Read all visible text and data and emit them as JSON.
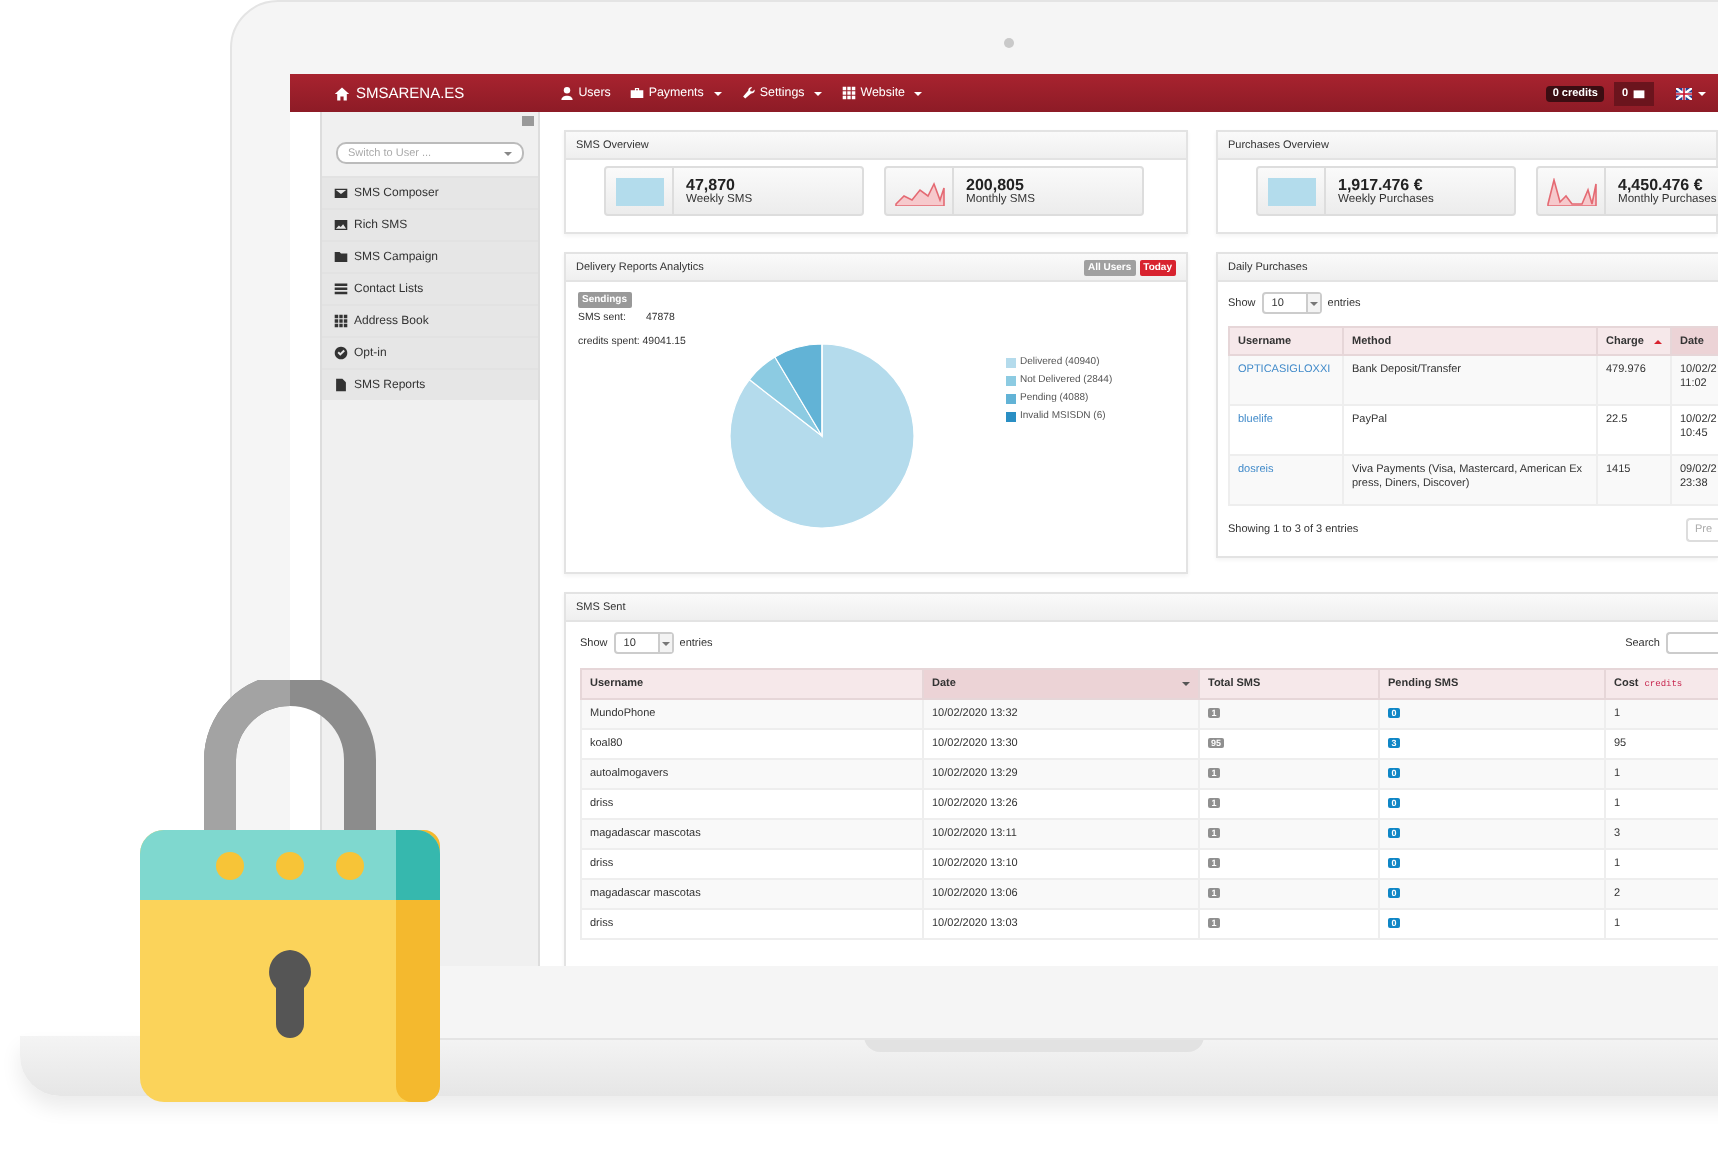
{
  "navbar": {
    "brand": "SMSARENA.ES",
    "menu": [
      {
        "label": "Users",
        "dropdown": false
      },
      {
        "label": "Payments",
        "dropdown": true
      },
      {
        "label": "Settings",
        "dropdown": true
      },
      {
        "label": "Website",
        "dropdown": true
      }
    ],
    "credits": "0 credits",
    "messages": "0"
  },
  "sidebar": {
    "switch_user": {
      "placeholder": "Switch to User ..."
    },
    "items": [
      {
        "label": "SMS Composer"
      },
      {
        "label": "Rich SMS"
      },
      {
        "label": "SMS Campaign"
      },
      {
        "label": "Contact Lists"
      },
      {
        "label": "Address Book"
      },
      {
        "label": "Opt-in"
      },
      {
        "label": "SMS Reports"
      }
    ]
  },
  "sms_overview": {
    "title": "SMS Overview",
    "stats": [
      {
        "kind": "tile",
        "value": "47,870",
        "label": "Weekly SMS"
      },
      {
        "kind": "sparkline",
        "value": "200,805",
        "label": "Monthly SMS"
      }
    ]
  },
  "purchases_overview": {
    "title": "Purchases Overview",
    "stats": [
      {
        "kind": "tile",
        "value": "1,917.476 €",
        "label": "Weekly Purchases"
      },
      {
        "kind": "spikes",
        "value": "4,450.476 €",
        "label": "Monthly Purchases"
      }
    ]
  },
  "delivery_reports": {
    "title": "Delivery Reports Analytics",
    "filters": [
      {
        "label": "All Users",
        "selected": false
      },
      {
        "label": "Today",
        "selected": true
      }
    ],
    "badge": "Sendings",
    "sms_sent_label": "SMS sent:",
    "sms_sent_value": "47878",
    "credits_spent": "credits spent: 49041.15",
    "chart_data": {
      "type": "pie",
      "categories": [
        "Delivered (40940)",
        "Not Delivered (2844)",
        "Pending (4088)",
        "Invalid MSISDN (6)"
      ],
      "values": [
        40940,
        2844,
        4088,
        6
      ]
    }
  },
  "daily_purchases": {
    "title": "Daily Purchases",
    "show_label": "Show",
    "page_size": "10",
    "entries_label": "entries",
    "columns": [
      {
        "label": "Username",
        "sorted": false
      },
      {
        "label": "Method",
        "sorted": false
      },
      {
        "label": "Charge",
        "sorted": true
      },
      {
        "label": "Date",
        "sorted": false
      }
    ],
    "rows": [
      {
        "username": "OPTICASIGLOXXI",
        "method": "Bank Deposit/Transfer",
        "charge": "479.976",
        "date_lines": [
          "10/02/2",
          "11:02"
        ]
      },
      {
        "username": "bluelife",
        "method": "PayPal",
        "charge": "22.5",
        "date_lines": [
          "10/02/2",
          "10:45"
        ]
      },
      {
        "username": "dosreis",
        "method": "Viva Payments (Visa, Mastercard, American Express, Diners, Discover)",
        "charge": "1415",
        "date_lines": [
          "09/02/2",
          "23:38"
        ]
      }
    ],
    "info": "Showing 1 to 3 of 3 entries",
    "prev": "Pre"
  },
  "sms_sent": {
    "title": "SMS Sent",
    "show_label": "Show",
    "page_size": "10",
    "entries_label": "entries",
    "search_label": "Search",
    "columns": [
      {
        "label": "Username",
        "sorted": false
      },
      {
        "label": "Date",
        "sorted": true
      },
      {
        "label": "Total SMS",
        "sorted": false
      },
      {
        "label": "Pending SMS",
        "sorted": false
      },
      {
        "label": "Cost",
        "sorted": false,
        "unit": "credits"
      }
    ],
    "rows": [
      {
        "username": "MundoPhone",
        "date": "10/02/2020 13:32",
        "total": "1",
        "pending": "0",
        "cost": "1"
      },
      {
        "username": "koal80",
        "date": "10/02/2020 13:30",
        "total": "95",
        "pending": "3",
        "cost": "95"
      },
      {
        "username": "autoalmogavers",
        "date": "10/02/2020 13:29",
        "total": "1",
        "pending": "0",
        "cost": "1"
      },
      {
        "username": "driss",
        "date": "10/02/2020 13:26",
        "total": "1",
        "pending": "0",
        "cost": "1"
      },
      {
        "username": "magadascar mascotas",
        "date": "10/02/2020 13:11",
        "total": "1",
        "pending": "0",
        "cost": "3"
      },
      {
        "username": "driss",
        "date": "10/02/2020 13:10",
        "total": "1",
        "pending": "0",
        "cost": "1"
      },
      {
        "username": "magadascar mascotas",
        "date": "10/02/2020 13:06",
        "total": "1",
        "pending": "0",
        "cost": "2"
      },
      {
        "username": "driss",
        "date": "10/02/2020 13:03",
        "total": "1",
        "pending": "0",
        "cost": "1"
      }
    ]
  }
}
